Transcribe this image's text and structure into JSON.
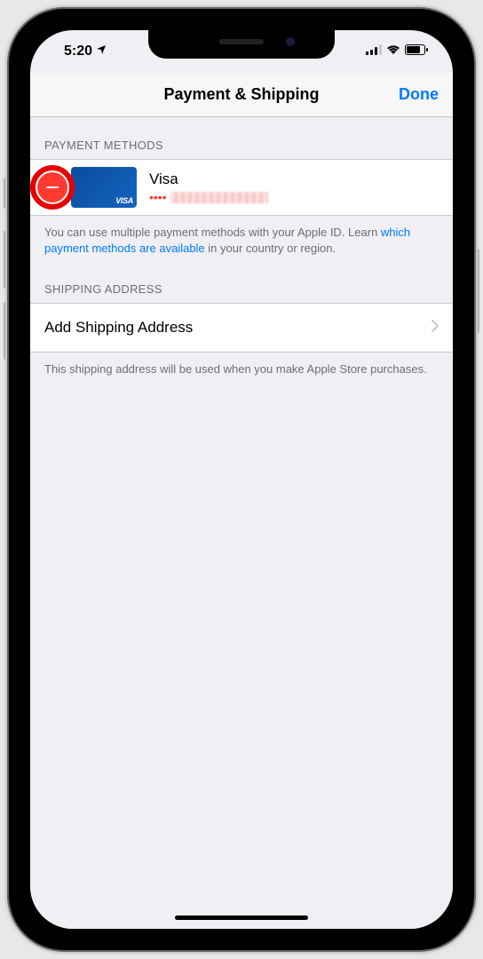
{
  "status_bar": {
    "time": "5:20"
  },
  "nav": {
    "title": "Payment & Shipping",
    "done_label": "Done"
  },
  "sections": {
    "payment": {
      "header": "PAYMENT METHODS",
      "card": {
        "brand": "Visa",
        "brand_logo": "VISA",
        "dots": "••••"
      },
      "footnote_prefix": "You can use multiple payment methods with your Apple ID. Learn ",
      "footnote_link": "which payment methods are available",
      "footnote_suffix": " in your country or region."
    },
    "shipping": {
      "header": "SHIPPING ADDRESS",
      "add_label": "Add Shipping Address",
      "footnote": "This shipping address will be used when you make Apple Store purchases."
    }
  }
}
